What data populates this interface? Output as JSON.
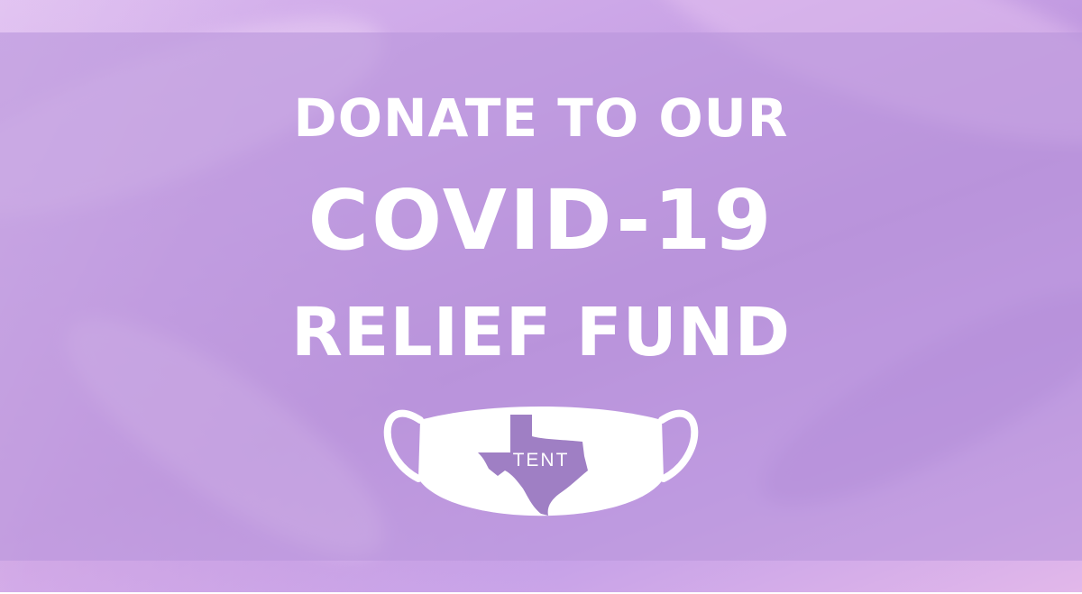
{
  "banner": {
    "line1": "DONATE TO OUR",
    "line2": "COVID-19",
    "line3": "RELIEF FUND"
  },
  "logo": {
    "icon": "face-mask-texas-icon",
    "label": "TENT"
  },
  "colors": {
    "background": "#c9a3e6",
    "overlay": "#ba96dc",
    "text": "#ffffff",
    "texas_shape": "#9f7fc4"
  }
}
